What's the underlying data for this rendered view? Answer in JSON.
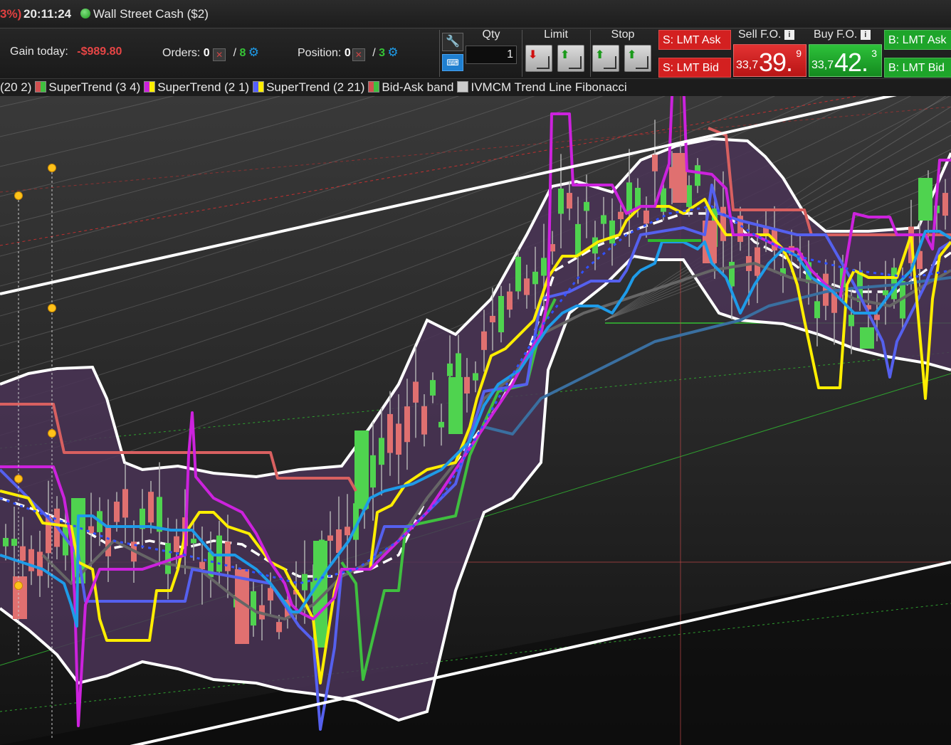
{
  "topbar": {
    "percent_fragment": "3%)",
    "clock": "20:11:24",
    "account": "Wall Street Cash ($2)"
  },
  "tradebar": {
    "gain_label": "Gain today:",
    "gain_value": "-$989.80",
    "orders_label": "Orders:",
    "orders_count": "0",
    "orders_auto": "8",
    "position_label": "Position:",
    "position_count": "0",
    "position_auto": "3",
    "separator": "/",
    "qty_label": "Qty",
    "qty_value": "1",
    "limit_label": "Limit",
    "stop_label": "Stop",
    "sell_lmt_ask": "S: LMT Ask",
    "sell_lmt_bid": "S: LMT Bid",
    "buy_lmt_ask": "B: LMT Ask",
    "buy_lmt_bid": "B: LMT Bid",
    "sell_fo_label": "Sell F.O.",
    "buy_fo_label": "Buy F.O.",
    "sell_price_prefix": "33,7",
    "sell_price_big": "39.",
    "sell_price_sup": "9",
    "buy_price_prefix": "33,7",
    "buy_price_big": "42.",
    "buy_price_sup": "3",
    "info_glyph": "i"
  },
  "legend": [
    {
      "label": "(20 2)",
      "color": ""
    },
    {
      "label": "SuperTrend (3 4)",
      "color": "#d05050"
    },
    {
      "label": "SuperTrend (2 1)",
      "color": "#ff33ff"
    },
    {
      "label": "SuperTrend (2 21)",
      "color": "#5560ff"
    },
    {
      "label": "Bid-Ask band",
      "color": "#d05050"
    },
    {
      "label": "IVMCM Trend Line Fibonacci",
      "color": "#cccccc"
    }
  ],
  "icons": {
    "wrench": "wrench-icon",
    "keyboard": "keyboard-icon",
    "gear": "gear-icon",
    "cancel": "cancel-icon",
    "info": "info-icon"
  },
  "colors": {
    "sell": "#d32020",
    "buy": "#1ea52a",
    "loss": "#e64545",
    "candle_up": "#4fd34f",
    "candle_down": "#e07070",
    "band_fill": "#4a3456",
    "magenta": "#cc22dd",
    "yellow": "#ffee00",
    "blue": "#1e9be8",
    "indigo": "#5560ee",
    "green": "#3fbf3f",
    "salmon": "#d86060"
  }
}
